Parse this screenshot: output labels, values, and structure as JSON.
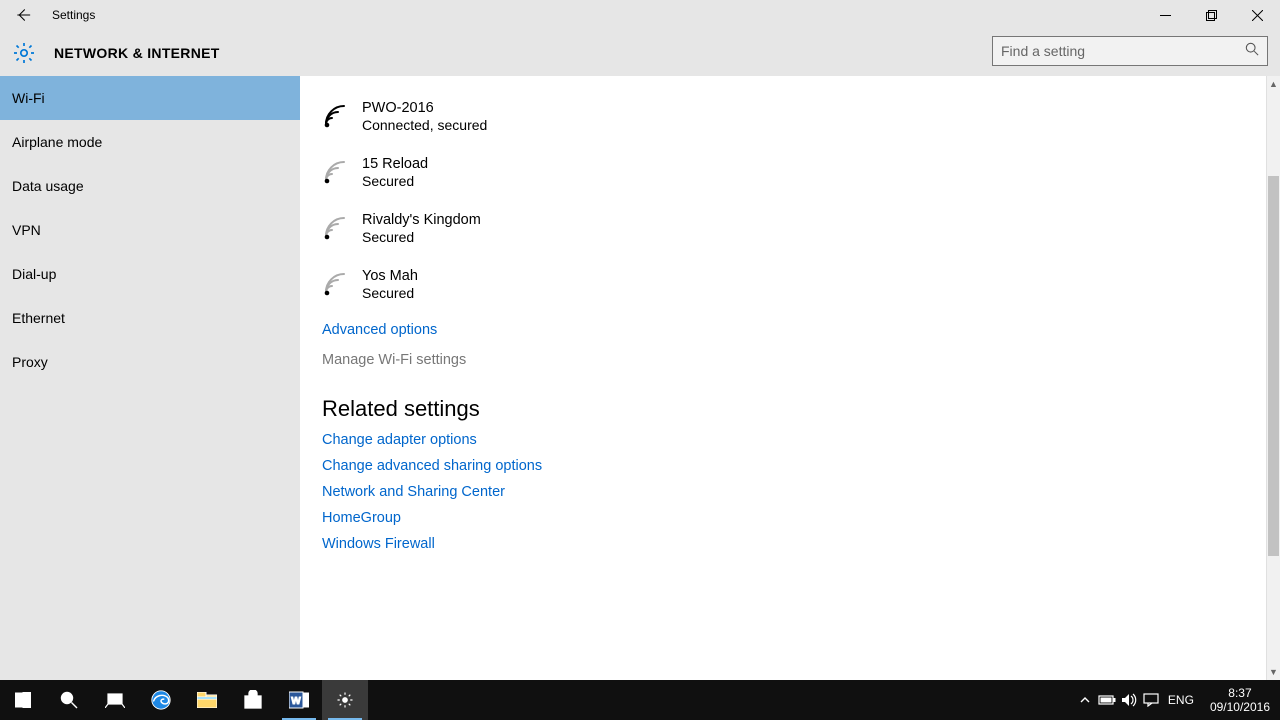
{
  "window": {
    "title": "Settings",
    "category": "NETWORK & INTERNET",
    "search_placeholder": "Find a setting"
  },
  "sidebar": {
    "items": [
      {
        "label": "Wi-Fi",
        "selected": true
      },
      {
        "label": "Airplane mode"
      },
      {
        "label": "Data usage"
      },
      {
        "label": "VPN"
      },
      {
        "label": "Dial-up"
      },
      {
        "label": "Ethernet"
      },
      {
        "label": "Proxy"
      }
    ]
  },
  "networks": [
    {
      "name": "PWO-2016",
      "status": "Connected, secured",
      "active": true
    },
    {
      "name": "15 Reload",
      "status": "Secured",
      "active": false
    },
    {
      "name": "Rivaldy's Kingdom",
      "status": "Secured",
      "active": false
    },
    {
      "name": "Yos Mah",
      "status": "Secured",
      "active": false
    }
  ],
  "links": {
    "advanced": "Advanced options",
    "manage": "Manage Wi-Fi settings"
  },
  "related": {
    "heading": "Related settings",
    "items": [
      "Change adapter options",
      "Change advanced sharing options",
      "Network and Sharing Center",
      "HomeGroup",
      "Windows Firewall"
    ]
  },
  "tray": {
    "lang": "ENG",
    "time": "8:37",
    "date": "09/10/2016"
  }
}
